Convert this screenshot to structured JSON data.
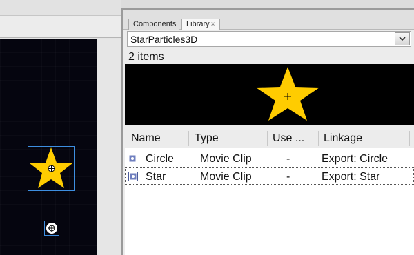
{
  "panel": {
    "tabs": [
      {
        "label": "Components"
      },
      {
        "label": "Library",
        "close": "×"
      }
    ],
    "document_select": {
      "value": "StarParticles3D"
    },
    "item_count": "2 items",
    "columns": [
      "Name",
      "Type",
      "Use ...",
      "Linkage"
    ],
    "items": [
      {
        "name": "Circle",
        "type": "Movie Clip",
        "use_count": "-",
        "linkage": "Export: Circle",
        "icon": "movie-clip-icon"
      },
      {
        "name": "Star",
        "type": "Movie Clip",
        "use_count": "-",
        "linkage": "Export: Star",
        "icon": "movie-clip-icon"
      }
    ]
  },
  "colors": {
    "star": "#ffcc00",
    "stage_background": "#05050f",
    "selection": "#3d8ee0",
    "preview_background": "#000000"
  }
}
